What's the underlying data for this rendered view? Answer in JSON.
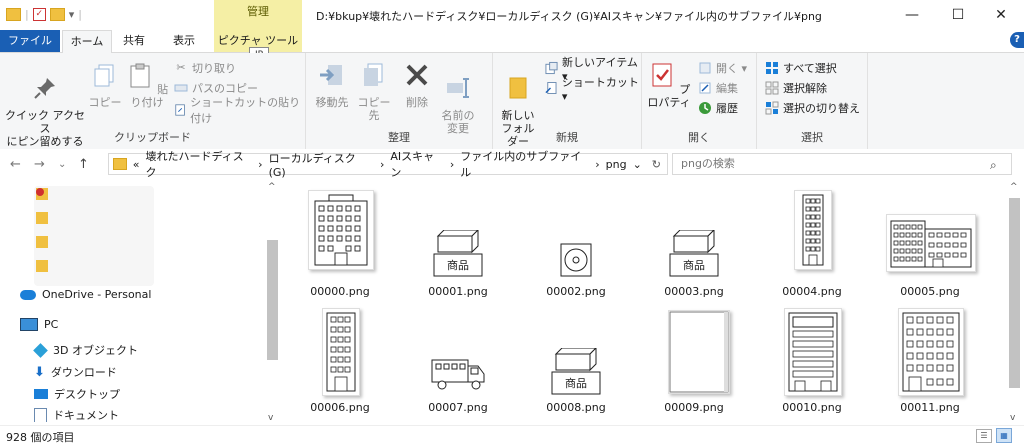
{
  "title_bar": {
    "context_tab": "管理",
    "path": "D:¥bkup¥壊れたハードディスク¥ローカルディスク (G)¥AIスキャン¥ファイル内のサブファイル¥png",
    "minimize": "—",
    "maximize": "☐",
    "close": "✕"
  },
  "tabs": {
    "file": "ファイル",
    "home": "ホーム",
    "share": "共有",
    "view": "表示",
    "picture_tools": "ピクチャ ツール",
    "keytip": "JP"
  },
  "ribbon": {
    "clipboard": {
      "label": "クリップボード",
      "pin": "クイック アクセス\nにピン留めする",
      "copy": "コピー",
      "paste": "貼り付け",
      "cut": "切り取り",
      "copy_path": "パスのコピー",
      "paste_shortcut": "ショートカットの貼り付け"
    },
    "organize": {
      "label": "整理",
      "move_to": "移動先",
      "copy_to": "コピー先",
      "delete": "削除",
      "rename": "名前の\n変更"
    },
    "new": {
      "label": "新規",
      "new_folder": "新しい\nフォルダー",
      "new_item": "新しいアイテム ▾",
      "shortcut": "ショートカット ▾"
    },
    "open": {
      "label": "開く",
      "properties": "プロパティ",
      "open": "開く ▾",
      "edit": "編集",
      "history": "履歴"
    },
    "select": {
      "label": "選択",
      "select_all": "すべて選択",
      "select_none": "選択解除",
      "invert": "選択の切り替え"
    }
  },
  "address": {
    "overflow": "«",
    "crumbs": [
      "壊れたハードディスク",
      "ローカルディスク (G)",
      "AIスキャン",
      "ファイル内のサブファイル",
      "png"
    ],
    "search_placeholder": "pngの検索"
  },
  "nav": {
    "onedrive": "OneDrive - Personal",
    "pc": "PC",
    "objects3d": "3D オブジェクト",
    "downloads": "ダウンロード",
    "desktop": "デスクトップ",
    "documents": "ドキュメント"
  },
  "files": [
    {
      "name": "00000.png",
      "label": ""
    },
    {
      "name": "00001.png",
      "label": "商品"
    },
    {
      "name": "00002.png",
      "label": ""
    },
    {
      "name": "00003.png",
      "label": "商品"
    },
    {
      "name": "00004.png",
      "label": ""
    },
    {
      "name": "00005.png",
      "label": ""
    },
    {
      "name": "00006.png",
      "label": ""
    },
    {
      "name": "00007.png",
      "label": ""
    },
    {
      "name": "00008.png",
      "label": "商品"
    },
    {
      "name": "00009.png",
      "label": ""
    },
    {
      "name": "00010.png",
      "label": ""
    },
    {
      "name": "00011.png",
      "label": ""
    }
  ],
  "status": {
    "count": "928 個の項目"
  },
  "colors": {
    "file_tab": "#1a5fb4",
    "context_tab": "#f5efa5",
    "folder": "#f0c040"
  }
}
